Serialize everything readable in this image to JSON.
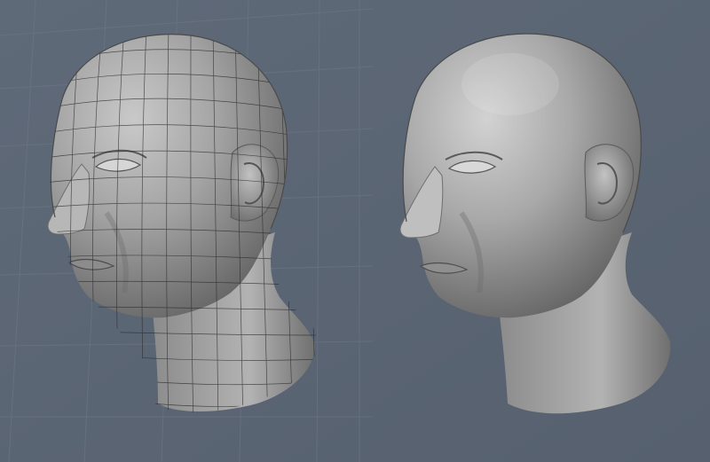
{
  "viewport": {
    "background_color": "#5b6675",
    "grid_color": "#6f7a88",
    "mesh_color": "#2a2a2a"
  },
  "models": [
    {
      "name": "wireframe-head",
      "shading": "smooth-with-mesh-overlay",
      "surface_color": "#9a9a9a"
    },
    {
      "name": "smooth-head",
      "shading": "smooth",
      "surface_color": "#9d9d9d"
    }
  ]
}
